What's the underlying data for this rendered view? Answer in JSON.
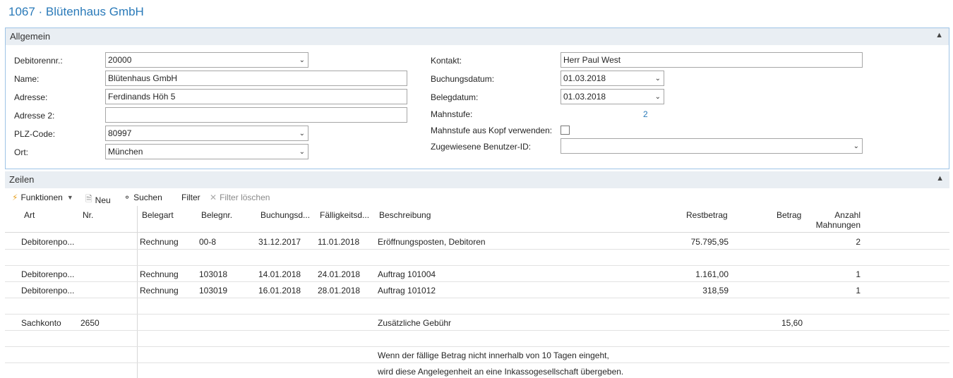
{
  "page_title": "1067 · Blütenhaus GmbH",
  "allgemein": {
    "title": "Allgemein",
    "collapse_icon": "chevron-up",
    "left": {
      "debitorennr_label": "Debitorennr.:",
      "debitorennr_value": "20000",
      "name_label": "Name:",
      "name_value": "Blütenhaus GmbH",
      "adresse_label": "Adresse:",
      "adresse_value": "Ferdinands Höh 5",
      "adresse2_label": "Adresse 2:",
      "adresse2_value": "",
      "plz_label": "PLZ-Code:",
      "plz_value": "80997",
      "ort_label": "Ort:",
      "ort_value": "München"
    },
    "right": {
      "kontakt_label": "Kontakt:",
      "kontakt_value": "Herr Paul West",
      "buchungsdatum_label": "Buchungsdatum:",
      "buchungsdatum_value": "01.03.2018",
      "belegdatum_label": "Belegdatum:",
      "belegdatum_value": "01.03.2018",
      "mahnstufe_label": "Mahnstufe:",
      "mahnstufe_value": "2",
      "mahnstufe_kopf_label": "Mahnstufe aus Kopf verwenden:",
      "mahnstufe_kopf_checked": false,
      "benutzer_label": "Zugewiesene Benutzer-ID:",
      "benutzer_value": ""
    }
  },
  "zeilen": {
    "title": "Zeilen",
    "toolbar": {
      "funktionen": "Funktionen",
      "neu": "Neu",
      "suchen": "Suchen",
      "filter": "Filter",
      "filter_loeschen": "Filter löschen"
    },
    "columns": {
      "art": "Art",
      "nr": "Nr.",
      "belegart": "Belegart",
      "belegnr": "Belegnr.",
      "buchungsd": "Buchungsd...",
      "faelligkeitsd": "Fälligkeitsd...",
      "beschreibung": "Beschreibung",
      "restbetrag": "Restbetrag",
      "betrag": "Betrag",
      "anzahl_line1": "Anzahl",
      "anzahl_line2": "Mahnungen"
    },
    "rows": [
      {
        "art": "Debitorenpo...",
        "nr": "",
        "belegart": "Rechnung",
        "belegnr": "00-8",
        "buchungsd": "31.12.2017",
        "faelligkeitsd": "11.01.2018",
        "beschreibung": "Eröffnungsposten, Debitoren",
        "restbetrag": "75.795,95",
        "betrag": "",
        "anzahl": "2"
      },
      {
        "art": "",
        "nr": "",
        "belegart": "",
        "belegnr": "",
        "buchungsd": "",
        "faelligkeitsd": "",
        "beschreibung": "",
        "restbetrag": "",
        "betrag": "",
        "anzahl": ""
      },
      {
        "art": "Debitorenpo...",
        "nr": "",
        "belegart": "Rechnung",
        "belegnr": "103018",
        "buchungsd": "14.01.2018",
        "faelligkeitsd": "24.01.2018",
        "beschreibung": "Auftrag 101004",
        "restbetrag": "1.161,00",
        "betrag": "",
        "anzahl": "1"
      },
      {
        "art": "Debitorenpo...",
        "nr": "",
        "belegart": "Rechnung",
        "belegnr": "103019",
        "buchungsd": "16.01.2018",
        "faelligkeitsd": "28.01.2018",
        "beschreibung": "Auftrag 101012",
        "restbetrag": "318,59",
        "betrag": "",
        "anzahl": "1"
      },
      {
        "art": "",
        "nr": "",
        "belegart": "",
        "belegnr": "",
        "buchungsd": "",
        "faelligkeitsd": "",
        "beschreibung": "",
        "restbetrag": "",
        "betrag": "",
        "anzahl": ""
      },
      {
        "art": "Sachkonto",
        "nr": "2650",
        "belegart": "",
        "belegnr": "",
        "buchungsd": "",
        "faelligkeitsd": "",
        "beschreibung": "Zusätzliche Gebühr",
        "restbetrag": "",
        "betrag": "15,60",
        "anzahl": ""
      },
      {
        "art": "",
        "nr": "",
        "belegart": "",
        "belegnr": "",
        "buchungsd": "",
        "faelligkeitsd": "",
        "beschreibung": "",
        "restbetrag": "",
        "betrag": "",
        "anzahl": ""
      },
      {
        "art": "",
        "nr": "",
        "belegart": "",
        "belegnr": "",
        "buchungsd": "",
        "faelligkeitsd": "",
        "beschreibung": "Wenn der fällige Betrag nicht innerhalb von 10 Tagen eingeht,",
        "restbetrag": "",
        "betrag": "",
        "anzahl": ""
      },
      {
        "art": "",
        "nr": "",
        "belegart": "",
        "belegnr": "",
        "buchungsd": "",
        "faelligkeitsd": "",
        "beschreibung": "wird diese Angelegenheit an eine Inkassogesellschaft übergeben.",
        "restbetrag": "",
        "betrag": "",
        "anzahl": ""
      }
    ]
  }
}
